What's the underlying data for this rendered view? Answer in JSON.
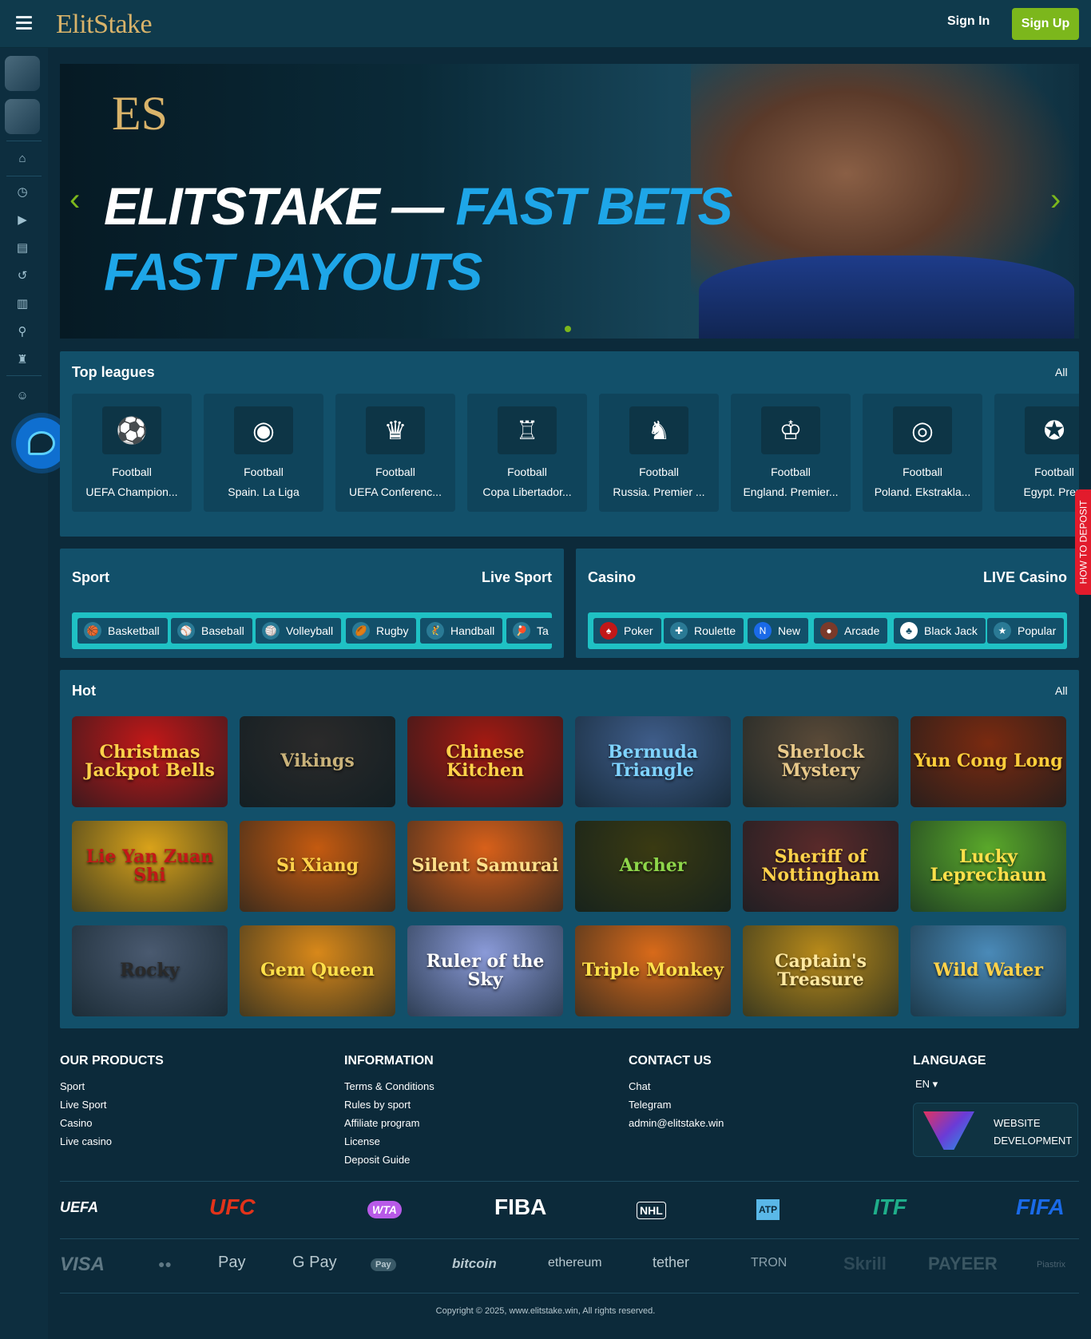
{
  "header": {
    "logo": "ElitStake",
    "signin_label": "Sign In",
    "signup_label": "Sign Up"
  },
  "sidebar": {
    "icons": [
      "home-icon",
      "stopwatch-icon",
      "play-icon",
      "store-icon",
      "history-icon",
      "store-alt-icon",
      "tennis-icon",
      "jersey-icon",
      "chat-icon"
    ]
  },
  "banner": {
    "badge": "ES",
    "line1_white": "ELITSTAKE — ",
    "line1_accent": "FAST BETS",
    "line2": "FAST PAYOUTS"
  },
  "top_leagues": {
    "title": "Top leagues",
    "all_label": "All",
    "items": [
      {
        "sport": "Football",
        "name": "UEFA Champion...",
        "icon": "⚽"
      },
      {
        "sport": "Football",
        "name": "Spain. La Liga",
        "icon": "◉"
      },
      {
        "sport": "Football",
        "name": "UEFA Conferenc...",
        "icon": "♛"
      },
      {
        "sport": "Football",
        "name": "Copa Libertador...",
        "icon": "♖"
      },
      {
        "sport": "Football",
        "name": "Russia. Premier ...",
        "icon": "♞"
      },
      {
        "sport": "Football",
        "name": "England. Premier...",
        "icon": "♔"
      },
      {
        "sport": "Football",
        "name": "Poland. Ekstrakla...",
        "icon": "◎"
      },
      {
        "sport": "Football",
        "name": "Egypt. Prem",
        "icon": "✪"
      }
    ]
  },
  "sport": {
    "title": "Sport",
    "live_label": "Live Sport",
    "chips": [
      {
        "label": "Basketball",
        "icon": "🏀"
      },
      {
        "label": "Baseball",
        "icon": "⚾"
      },
      {
        "label": "Volleyball",
        "icon": "🏐"
      },
      {
        "label": "Rugby",
        "icon": "🏉"
      },
      {
        "label": "Handball",
        "icon": "🤾"
      },
      {
        "label": "Ta",
        "icon": "🏓"
      }
    ]
  },
  "casino": {
    "title": "Casino",
    "live_label": "LIVE Casino",
    "chips": [
      {
        "label": "Poker",
        "icon": "♠"
      },
      {
        "label": "Roulette",
        "icon": "✚"
      },
      {
        "label": "New",
        "icon": "N"
      },
      {
        "label": "Arcade",
        "icon": "●"
      },
      {
        "label": "Black Jack",
        "icon": "♣"
      },
      {
        "label": "Popular",
        "icon": "★"
      }
    ]
  },
  "hot": {
    "title": "Hot",
    "all_label": "All",
    "games": [
      {
        "title": "Christmas Jackpot Bells",
        "bg": "#c21818",
        "fg": "#ffd24a"
      },
      {
        "title": "Vikings",
        "bg": "#2b2a2a",
        "fg": "#c9b27a"
      },
      {
        "title": "Chinese Kitchen",
        "bg": "#a31a12",
        "fg": "#ffd24a"
      },
      {
        "title": "Bermuda Triangle",
        "bg": "#3f5d8a",
        "fg": "#7fd3ff"
      },
      {
        "title": "Sherlock Mystery",
        "bg": "#5a4a38",
        "fg": "#e8c98a"
      },
      {
        "title": "Yun Cong Long",
        "bg": "#7a2a10",
        "fg": "#ffce3a"
      },
      {
        "title": "Lie Yan Zuan Shi",
        "bg": "#d9a21a",
        "fg": "#c21818"
      },
      {
        "title": "Si Xiang",
        "bg": "#c45a10",
        "fg": "#ffd24a"
      },
      {
        "title": "Silent Samurai",
        "bg": "#d8601a",
        "fg": "#ffe08a"
      },
      {
        "title": "Archer",
        "bg": "#3a3a12",
        "fg": "#8ed64a"
      },
      {
        "title": "Sheriff of Nottingham",
        "bg": "#5a2a2a",
        "fg": "#ffd24a"
      },
      {
        "title": "Lucky Leprechaun",
        "bg": "#5aa82a",
        "fg": "#ffe04a"
      },
      {
        "title": "Rocky",
        "bg": "#4a5a70",
        "fg": "#2a2a2a"
      },
      {
        "title": "Gem Queen",
        "bg": "#d8881a",
        "fg": "#ffe04a"
      },
      {
        "title": "Ruler of the Sky",
        "bg": "#8a9ad8",
        "fg": "#ffffff"
      },
      {
        "title": "Triple Monkey",
        "bg": "#d86a1a",
        "fg": "#ffe04a"
      },
      {
        "title": "Captain's Treasure",
        "bg": "#b88a1a",
        "fg": "#ffe8a0"
      },
      {
        "title": "Wild Water",
        "bg": "#4a8ab8",
        "fg": "#ffd24a"
      }
    ]
  },
  "footer": {
    "products": {
      "title": "OUR PRODUCTS",
      "links": [
        "Sport",
        "Live Sport",
        "Casino",
        "Live casino"
      ]
    },
    "information": {
      "title": "INFORMATION",
      "links": [
        "Terms & Conditions",
        "Rules by sport",
        "Affiliate program",
        "License",
        "Deposit Guide"
      ]
    },
    "contact": {
      "title": "CONTACT US",
      "links": [
        "Chat",
        "Telegram",
        "admin@elitstake.win"
      ]
    },
    "language": {
      "title": "LANGUAGE",
      "value": "EN ▾"
    },
    "webdev": {
      "line1": "WEBSITE",
      "line2": "DEVELOPMENT"
    },
    "brands": [
      {
        "label": "UEFA",
        "color": "#ffffff"
      },
      {
        "label": "UFC",
        "color": "#e2331a"
      },
      {
        "label": "WTA",
        "color": "#b85ae8"
      },
      {
        "label": "FIBA",
        "color": "#ffffff"
      },
      {
        "label": "NHL",
        "color": "#ffffff"
      },
      {
        "label": "ATP",
        "color": "#5ab8e8"
      },
      {
        "label": "ITF",
        "color": "#1fae8a"
      },
      {
        "label": "FIFA",
        "color": "#1a6ae8"
      }
    ],
    "payments": [
      "VISA",
      "●●",
      "Pay",
      "G Pay",
      "Pay",
      "bitcoin",
      "ethereum",
      "tether",
      "TRON",
      "Skrill",
      "PAYEER",
      "Piastrix"
    ],
    "copyright": "Copyright © 2025, www.elitstake.win, All rights reserved."
  },
  "deposit_tab": "HOW TO DEPOSIT"
}
